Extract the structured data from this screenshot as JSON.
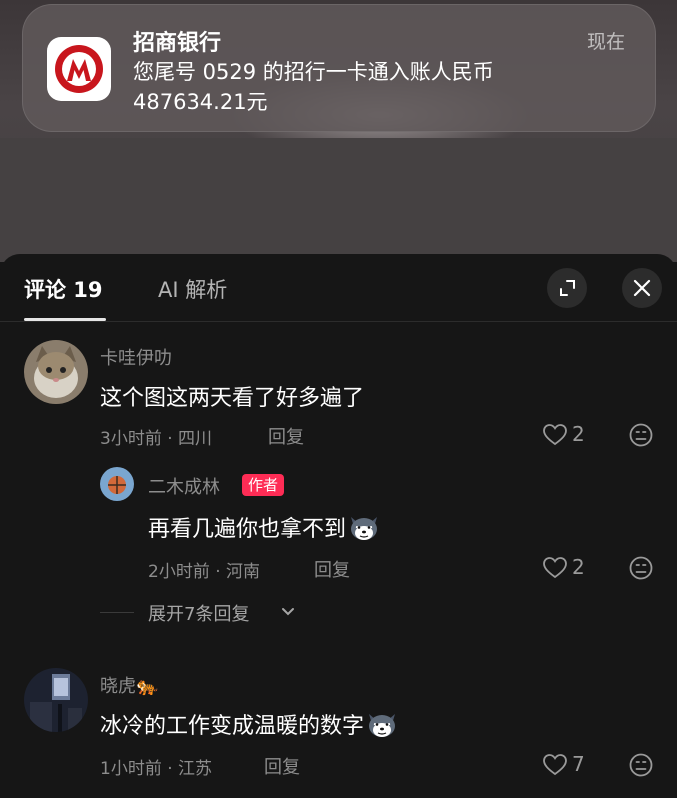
{
  "notification": {
    "app_name": "招商银行",
    "time": "现在",
    "message": "您尾号 0529 的招行一卡通入账人民币 487634.21元",
    "icon": "cmb-bank-logo"
  },
  "comments_panel": {
    "tabs": [
      {
        "label": "评论 19",
        "active": true
      },
      {
        "label": "AI 解析",
        "active": false
      }
    ],
    "expand_icon": "expand-icon",
    "close_icon": "close-icon",
    "comments": [
      {
        "username": "卡哇伊叻",
        "text": "这个图这两天看了好多遍了",
        "meta": "3小时前 · 四川",
        "reply_label": "回复",
        "likes": "2"
      },
      {
        "username": "二木成林",
        "author_badge": "作者",
        "text": "再看几遍你也拿不到",
        "emoji": "husky-emoji",
        "meta": "2小时前 · 河南",
        "reply_label": "回复",
        "likes": "2"
      },
      {
        "username": "晓虎🐅",
        "text": "冰冷的工作变成温暖的数字",
        "emoji": "husky-emoji",
        "meta": "1小时前 · 江苏",
        "reply_label": "回复",
        "likes": "7"
      }
    ],
    "expand_replies": "展开7条回复"
  },
  "colors": {
    "panel_bg": "#161616",
    "author_badge": "#fe2c55",
    "bank_red": "#c8161d"
  }
}
